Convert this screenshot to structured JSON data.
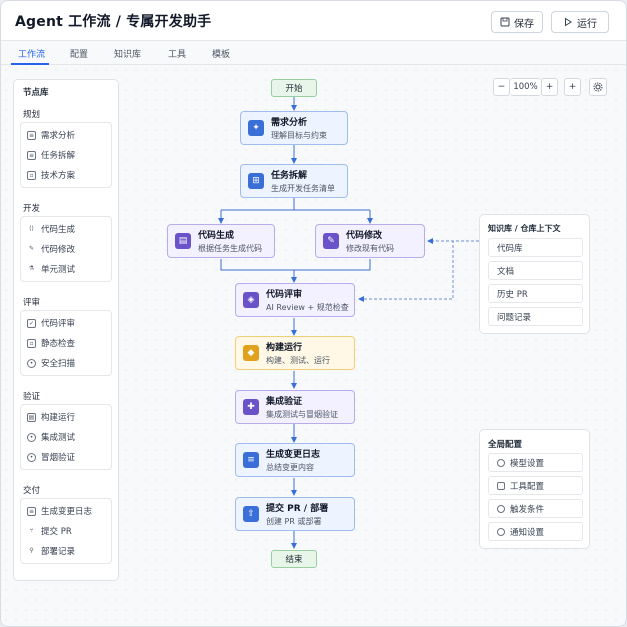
{
  "header": {
    "title": "Agent 工作流 / 专属开发助手",
    "save_label": "保存",
    "run_label": "运行"
  },
  "tabs": [
    {
      "label": "工作流",
      "active": true
    },
    {
      "label": "配置"
    },
    {
      "label": "知识库"
    },
    {
      "label": "工具"
    },
    {
      "label": "模板"
    }
  ],
  "library": {
    "title": "节点库",
    "groups": [
      {
        "title": "规划",
        "items": [
          "需求分析",
          "任务拆解",
          "技术方案"
        ]
      },
      {
        "title": "开发",
        "items": [
          "代码生成",
          "代码修改",
          "单元测试"
        ]
      },
      {
        "title": "评审",
        "items": [
          "代码评审",
          "静态检查",
          "安全扫描"
        ]
      },
      {
        "title": "验证",
        "items": [
          "构建运行",
          "集成测试",
          "冒烟验证"
        ]
      },
      {
        "title": "交付",
        "items": [
          "生成变更日志",
          "提交 PR",
          "部署记录"
        ]
      }
    ]
  },
  "zoom": {
    "minus": "−",
    "level": "100%",
    "plus": "+",
    "add": "+"
  },
  "flow": {
    "start": "开始",
    "end": "结束",
    "nodes": {
      "requirement": {
        "title": "需求分析",
        "subtitle": "理解目标与约束"
      },
      "breakdown": {
        "title": "任务拆解",
        "subtitle": "生成开发任务清单"
      },
      "codegen": {
        "title": "代码生成",
        "subtitle": "根据任务生成代码"
      },
      "codemod": {
        "title": "代码修改",
        "subtitle": "修改现有代码"
      },
      "review": {
        "title": "代码评审",
        "subtitle": "AI Review + 规范检查"
      },
      "build": {
        "title": "构建运行",
        "subtitle": "构建、测试、运行"
      },
      "integration": {
        "title": "集成验证",
        "subtitle": "集成测试与冒烟验证"
      },
      "changelog": {
        "title": "生成变更日志",
        "subtitle": "总结变更内容"
      },
      "submit": {
        "title": "提交 PR / 部署",
        "subtitle": "创建 PR 或部署"
      }
    }
  },
  "knowledge": {
    "title": "知识库 / 仓库上下文",
    "items": [
      "代码库",
      "文档",
      "历史 PR",
      "问题记录"
    ]
  },
  "global_config": {
    "title": "全局配置",
    "items": [
      "模型设置",
      "工具配置",
      "触发条件",
      "通知设置"
    ]
  }
}
